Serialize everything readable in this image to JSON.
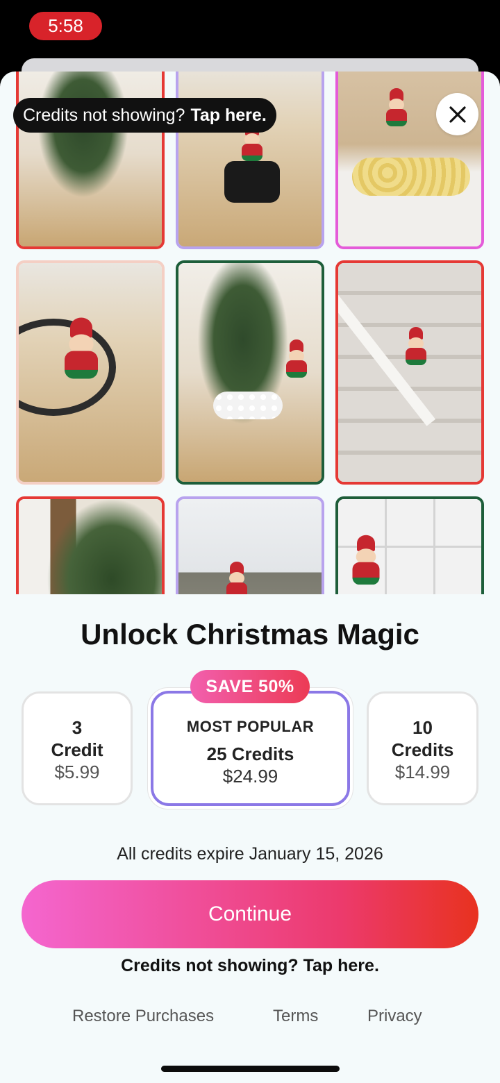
{
  "status_bar": {
    "time": "5:58"
  },
  "banner": {
    "text": "Credits not showing?",
    "link": "Tap here."
  },
  "gallery": {
    "tiles": [
      {
        "border": "#e53935",
        "scene": "tree-and-train"
      },
      {
        "border": "#b8a3ee",
        "scene": "elf-on-police-car"
      },
      {
        "border": "#e45bd9",
        "scene": "elf-with-chips"
      },
      {
        "border": "#f4cfc4",
        "scene": "elf-on-train-track"
      },
      {
        "border": "#1d5e3a",
        "scene": "elf-snowball-fight"
      },
      {
        "border": "#e53935",
        "scene": "elf-on-stair-rail"
      },
      {
        "border": "#e53935",
        "scene": "tree-with-lights"
      },
      {
        "border": "#b8a3ee",
        "scene": "elf-on-table"
      },
      {
        "border": "#1d5e3a",
        "scene": "elf-on-tiles"
      }
    ]
  },
  "paywall": {
    "title": "Unlock Christmas Magic",
    "plans": [
      {
        "qty": "3",
        "unit": "Credit",
        "price": "$5.99"
      },
      {
        "badge": "MOST POPULAR",
        "unit": "25 Credits",
        "price": "$24.99",
        "save": "SAVE 50%"
      },
      {
        "qty": "10",
        "unit": "Credits",
        "price": "$14.99"
      }
    ],
    "selected_plan": 1,
    "expiry_note": "All credits expire January 15, 2026",
    "continue_label": "Continue",
    "credits_link": "Credits not showing? Tap here.",
    "footer": {
      "restore": "Restore Purchases",
      "terms": "Terms",
      "privacy": "Privacy"
    }
  },
  "colors": {
    "accent_purple": "#8b78e6",
    "save_gradient": [
      "#f25fae",
      "#ec3b55"
    ],
    "continue_gradient": [
      "#f466cf",
      "#e8321f"
    ],
    "time_pill": "#d8232a"
  },
  "icons": {
    "close": "close-icon"
  }
}
